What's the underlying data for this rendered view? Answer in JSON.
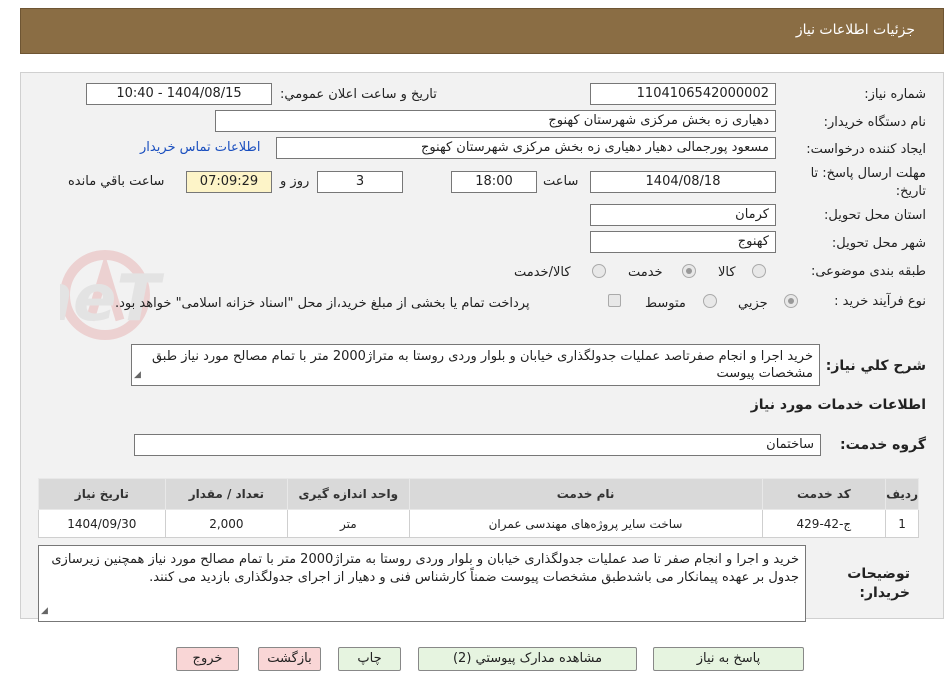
{
  "header": {
    "title": "جزئیات اطلاعات نیاز"
  },
  "form": {
    "need_number_label": "شماره نیاز:",
    "need_number": "1104106542000002",
    "announce_label": "تاریخ و ساعت اعلان عمومي:",
    "announce_value": "1404/08/15 - 10:40",
    "buyer_org_label": "نام دستگاه خريدار:",
    "buyer_org": "دهیاری زه بخش مرکزی شهرستان کهنوج",
    "requester_label": "ايجاد کننده درخواست:",
    "requester": "مسعود پورجمالی دهیار دهیاری زه بخش مرکزی شهرستان کهنوج",
    "contact_link": "اطلاعات تماس خریدار",
    "deadline_label_1": "مهلت ارسال پاسخ: تا",
    "deadline_label_2": "تاریخ:",
    "deadline_date": "1404/08/18",
    "time_label": "ساعت",
    "deadline_time": "18:00",
    "days_value": "3",
    "days_label": "روز و",
    "remaining_time": "07:09:29",
    "remaining_label": "ساعت باقي مانده",
    "province_label": "استان محل تحويل:",
    "province": "کرمان",
    "city_label": "شهر محل تحويل:",
    "city": "کهنوج",
    "category_label": "طبقه بندی موضوعی:",
    "category_options": [
      "کالا",
      "خدمت",
      "کالا/خدمت"
    ],
    "category_selected": "خدمت",
    "process_label": "نوع فرآیند خرید :",
    "process_options": [
      "جزيي",
      "متوسط"
    ],
    "process_selected": "جزيي",
    "process_note": "پرداخت تمام یا بخشی از مبلغ خرید،از محل \"اسناد خزانه اسلامی\" خواهد بود.",
    "description_label": "شرح کلي نياز:",
    "description": "خرید اجرا و انجام صفرتاصد عملیات جدولگذاری خیابان و بلوار وردی روستا به متراژ2000 متر با تمام مصالح مورد نیاز طبق مشخصات پیوست",
    "services_title": "اطلاعات خدمات مورد نياز",
    "service_group_label": "گروه خدمت:",
    "service_group": "ساختمان"
  },
  "table": {
    "headers": [
      "رديف",
      "کد خدمت",
      "نام خدمت",
      "واحد اندازه گیری",
      "تعداد / مقدار",
      "تاریخ نیاز"
    ],
    "rows": [
      [
        "1",
        "ج-42-429",
        "ساخت سایر پروژه‌های مهندسی عمران",
        "متر",
        "2,000",
        "1404/09/30"
      ]
    ]
  },
  "buyer_notes_label_1": "توضیحات",
  "buyer_notes_label_2": "خریدار:",
  "buyer_notes": "خرید و اجرا و انجام  صفر تا صد عملیات جدولگذاری خیابان و بلوار وردی روستا به متراژ2000 متر با تمام مصالح مورد نیاز همچنین زیرسازی جدول بر عهده پیمانکار می باشدطبق مشخصات پیوست ضمناً کارشناس فنی و دهیار از اجرای جدولگذاری بازدید می کنند.",
  "buttons": {
    "reply": "پاسخ به نياز",
    "attachments": "مشاهده مدارک پيوستي (2)",
    "print": "چاپ",
    "back": "بازگشت",
    "exit": "خروج"
  },
  "watermark": "AriaTender.neT",
  "colors": {
    "header_bg": "#8a6d44",
    "button_green": "#e6f4e0",
    "button_pink": "#f9d6d6",
    "timer_bg": "#fdf4c8",
    "link": "#1a4fbf"
  }
}
